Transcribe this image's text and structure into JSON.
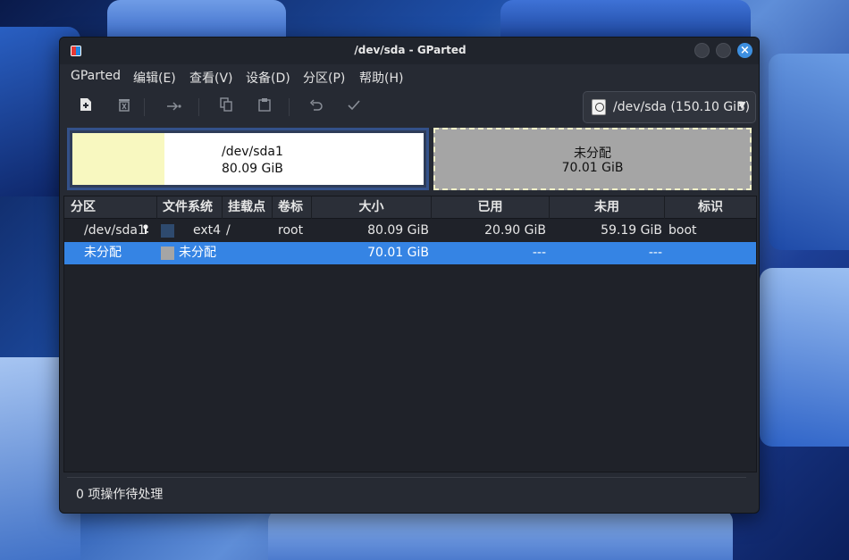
{
  "window": {
    "title": "/dev/sda - GParted"
  },
  "menu": [
    "GParted",
    "编辑(E)",
    "查看(V)",
    "设备(D)",
    "分区(P)",
    "帮助(H)"
  ],
  "toolbar": {
    "device_selector": "/dev/sda (150.10 GiB)"
  },
  "partition_map": {
    "partition": {
      "name": "/dev/sda1",
      "size": "80.09 GiB",
      "used_fraction": 0.26
    },
    "unallocated": {
      "name": "未分配",
      "size": "70.01 GiB"
    }
  },
  "table": {
    "headers": [
      "分区",
      "文件系统",
      "挂载点",
      "卷标",
      "大小",
      "已用",
      "未用",
      "标识"
    ],
    "rows": [
      {
        "partition": "/dev/sda1",
        "filesystem": "ext4",
        "mountpoint": "/",
        "label": "root",
        "size": "80.09 GiB",
        "used": "20.90 GiB",
        "unused": "59.19 GiB",
        "flags": "boot",
        "swatch": "#2e4a6e",
        "locked": true
      },
      {
        "partition": "未分配",
        "filesystem": "未分配",
        "mountpoint": "",
        "label": "",
        "size": "70.01 GiB",
        "used": "---",
        "unused": "---",
        "flags": "",
        "swatch": "#a5a5a5",
        "locked": false
      }
    ]
  },
  "status": {
    "text": "0 项操作待处理"
  },
  "colors": {
    "accent": "#3584e4",
    "used_space": "#f8f8c0",
    "unallocated": "#a5a5a5",
    "ext4": "#2e4a6e"
  }
}
